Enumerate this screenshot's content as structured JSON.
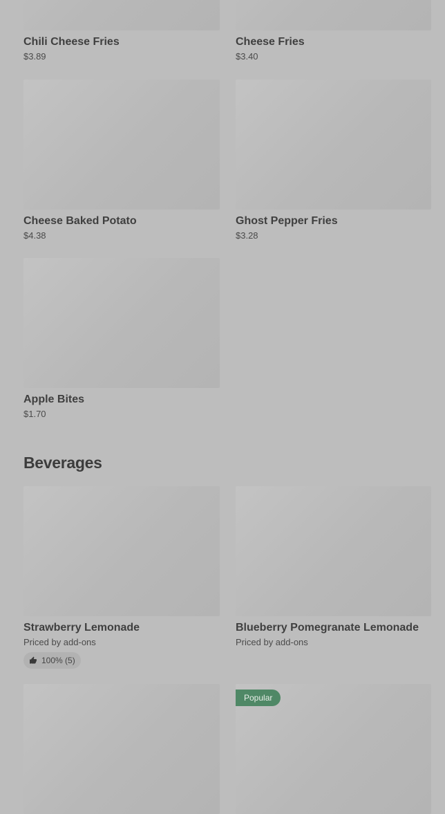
{
  "menu": {
    "items_top": [
      {
        "name": "Chili Cheese Fries",
        "price": "$3.89"
      },
      {
        "name": "Cheese Fries",
        "price": "$3.40"
      },
      {
        "name": "Cheese Baked Potato",
        "price": "$4.38"
      },
      {
        "name": "Ghost Pepper Fries",
        "price": "$3.28"
      },
      {
        "name": "Apple Bites",
        "price": "$1.70"
      }
    ]
  },
  "beverages": {
    "title": "Beverages",
    "items": [
      {
        "name": "Strawberry Lemonade",
        "price": "Priced by add-ons",
        "rating": "100% (5)"
      },
      {
        "name": "Blueberry Pomegranate Lemonade",
        "price": "Priced by add-ons"
      }
    ],
    "popular_badge": "Popular"
  },
  "icons": {
    "rating": "thumbs-up-icon"
  },
  "colors": {
    "background": "#bdbdbd",
    "popular_badge": "#4f8866"
  }
}
